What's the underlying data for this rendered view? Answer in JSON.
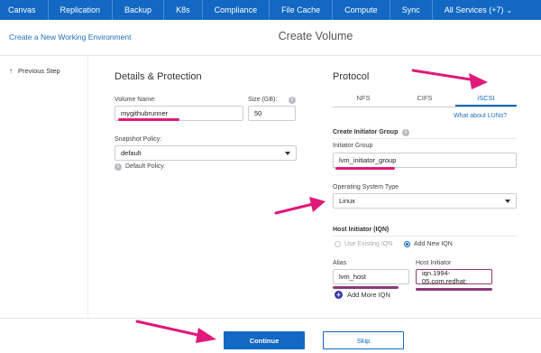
{
  "nav": {
    "items": [
      "Canvas",
      "Replication",
      "Backup",
      "K8s",
      "Compliance",
      "File Cache",
      "Compute",
      "Sync",
      "All Services (+7)"
    ],
    "color": "#1268c2"
  },
  "header": {
    "create_link": "Create a New Working Environment",
    "title": "Create Volume"
  },
  "sidebar": {
    "previous_step": "Previous Step"
  },
  "details": {
    "title": "Details & Protection",
    "volume_name_label": "Volume Name:",
    "volume_name_value": "mygithubrunner",
    "size_label": "Size (GB):",
    "size_value": "50",
    "snapshot_label": "Snapshot Policy:",
    "snapshot_value": "default",
    "default_policy_label": "Default Policy"
  },
  "protocol": {
    "title": "Protocol",
    "tabs": [
      "NFS",
      "CIFS",
      "iSCSI"
    ],
    "active_tab": "iSCSI",
    "luns_link": "What about LUNs?",
    "create_group_title": "Create Initiator Group",
    "initiator_group_label": "Initiator Group",
    "initiator_group_value": "lvm_initiator_group",
    "os_label": "Operating System Type",
    "os_value": "Linux",
    "host_initiator_title": "Host Initiator (IQN)",
    "use_existing_label": "Use Existing IQN",
    "add_new_label": "Add New IQN",
    "alias_label": "Alias",
    "alias_value": "lvm_host",
    "host_initiator_label": "Host Initiator",
    "host_initiator_value": "iqn.1994-05.com.redhat:",
    "add_more_label": "Add More IQN"
  },
  "footer": {
    "continue_label": "Continue",
    "skip_label": "Skip"
  },
  "annotation_color": "#e0197a"
}
